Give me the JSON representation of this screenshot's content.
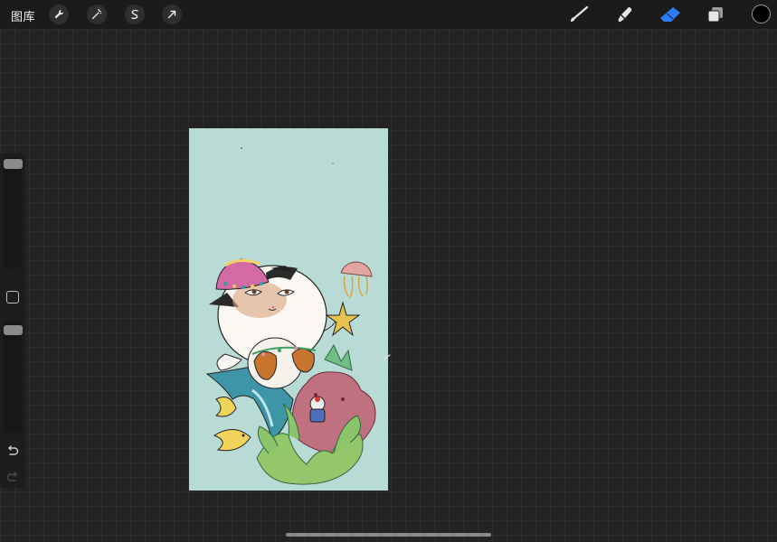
{
  "toolbar": {
    "gallery_label": "图库",
    "icons": [
      "wrench-icon",
      "magic-wand-icon",
      "selection-icon",
      "transform-arrow-icon"
    ],
    "right_tools": [
      "brush-icon",
      "smudge-icon",
      "eraser-icon",
      "layers-icon"
    ],
    "active_tool": "eraser",
    "current_color": "#000000",
    "accent_color": "#2f7bf6"
  },
  "sidebar": {
    "controls": [
      "brush-size-slider",
      "modify-button",
      "opacity-slider",
      "undo-icon",
      "redo-icon"
    ]
  },
  "canvas": {
    "background_color": "#b8dbd5"
  }
}
